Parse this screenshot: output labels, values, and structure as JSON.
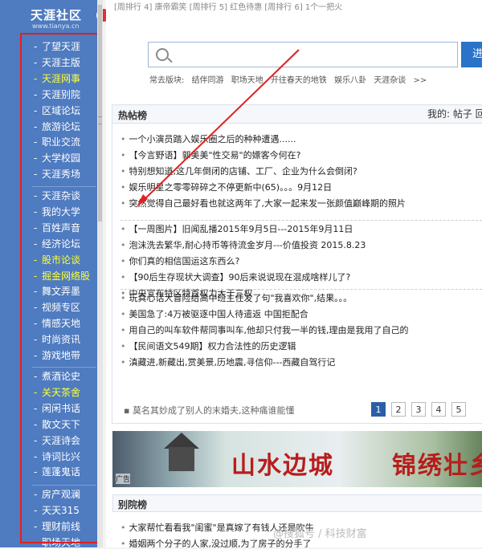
{
  "logo": {
    "title": "天涯社区",
    "url": "www.tianya.cn"
  },
  "topline": "[周排行 4]  康帝霸笑      [周排行 5]  红色待惠      [周排行 6]  1个一把火",
  "sidebar": {
    "group1": [
      {
        "label": "了望天涯",
        "hl": false
      },
      {
        "label": "天涯主版",
        "hl": false
      },
      {
        "label": "天涯网事",
        "hl": true
      },
      {
        "label": "天涯别院",
        "hl": false
      },
      {
        "label": "区域论坛",
        "hl": false
      },
      {
        "label": "旅游论坛",
        "hl": false
      },
      {
        "label": "职业交流",
        "hl": false
      },
      {
        "label": "大学校园",
        "hl": false
      },
      {
        "label": "天涯秀场",
        "hl": false
      }
    ],
    "group2": [
      {
        "label": "天涯杂谈",
        "hl": false
      },
      {
        "label": "我的大学",
        "hl": false
      },
      {
        "label": "百姓声音",
        "hl": false
      },
      {
        "label": "经济论坛",
        "hl": false
      },
      {
        "label": "股市论谈",
        "hl": true
      },
      {
        "label": "掘金网络股",
        "hl": true
      },
      {
        "label": "舞文弄墨",
        "hl": false
      },
      {
        "label": "视频专区",
        "hl": false
      },
      {
        "label": "情感天地",
        "hl": false
      },
      {
        "label": "时尚资讯",
        "hl": false
      },
      {
        "label": "游戏地带",
        "hl": false
      }
    ],
    "group3": [
      {
        "label": "煮酒论史",
        "hl": false
      },
      {
        "label": "关天茶舍",
        "hl": true
      },
      {
        "label": "闲闲书话",
        "hl": false
      },
      {
        "label": "散文天下",
        "hl": false
      },
      {
        "label": "天涯诗会",
        "hl": false
      },
      {
        "label": "诗词比兴",
        "hl": false
      },
      {
        "label": "莲蓬鬼话",
        "hl": false
      }
    ],
    "group4": [
      {
        "label": "房产观澜",
        "hl": false
      },
      {
        "label": "天天315",
        "hl": false
      },
      {
        "label": "理财前线",
        "hl": false
      },
      {
        "label": "职场天地",
        "hl": false
      }
    ]
  },
  "search": {
    "button": "进",
    "placeholder": ""
  },
  "quick": {
    "label": "常去版块:",
    "items": [
      "结伴同游",
      "职场天地",
      "开往春天的地铁",
      "娱乐八卦",
      "天涯杂谈"
    ],
    "more": ">>"
  },
  "hot": {
    "title": "热帖榜",
    "right": "我的: 帖子  回",
    "groups": [
      [
        {
          "text": "一个小演员踏入娱乐圈之后的种种遭遇......"
        },
        {
          "text": "【今言野语】郭美美\"性交易\"的嫖客今何在?"
        },
        {
          "text": "特别想知道,这几年倒闭的店铺、工厂、企业为什么会倒闭?"
        },
        {
          "text": "娱乐明星之零零碎碎之不停更新中(65)。。。9月12日"
        },
        {
          "text": "突然觉得自己最好看也就这两年了,大家一起来发一张颜值巅峰期的照片"
        }
      ],
      [
        {
          "text": "【一周图片】旧闻乱播2015年9月5日---2015年9月11日"
        },
        {
          "text": "泡沫洗去繁华,耐心持币等待流金岁月---价值投资 2015.8.23"
        },
        {
          "text": "你们真的相信国运这东西么?"
        },
        {
          "text": "【90后生存现状大调查】90后来说说现在混成啥样儿了?"
        },
        {
          "text": "中央宣布特区特首权力大于三权"
        }
      ],
      [
        {
          "text": "玩真心话大冒险给高中班主任发了句\"我喜欢你\",结果。。。"
        },
        {
          "text": "美国急了:4万被驱逐中国人待遣返 中国拒配合"
        },
        {
          "text": "用自己的叫车软件帮同事叫车,他却只付我一半的钱,理由是我用了自己的"
        },
        {
          "text": "【民间语文549期】权力合法性的历史逻辑"
        },
        {
          "text": "滇藏进,新藏出,赏美景,历地震,寻信仰---西藏自驾行记"
        }
      ]
    ],
    "tip": "莫名其妙成了别人的末婚夫,这种痛谁能懂",
    "pages": [
      "1",
      "2",
      "3",
      "4",
      "5"
    ]
  },
  "banner": {
    "text1": "山水边城",
    "text2": "锦绣壮乡",
    "ad": "广告"
  },
  "bie": {
    "title": "别院榜",
    "rows": [
      {
        "text": "大家帮忙看看我\"闺蜜\"是真嫁了有钱人还是吹牛"
      },
      {
        "text": "婚姻两个分子的人家,没过顺,为了房子的分手了"
      }
    ]
  },
  "watermark": "@搜狐号 / 科技财富",
  "colors": {
    "sidebar": "#4f7bc0",
    "highlight": "#ffff33",
    "frame": "#e02020",
    "accent": "#2a73c8"
  }
}
